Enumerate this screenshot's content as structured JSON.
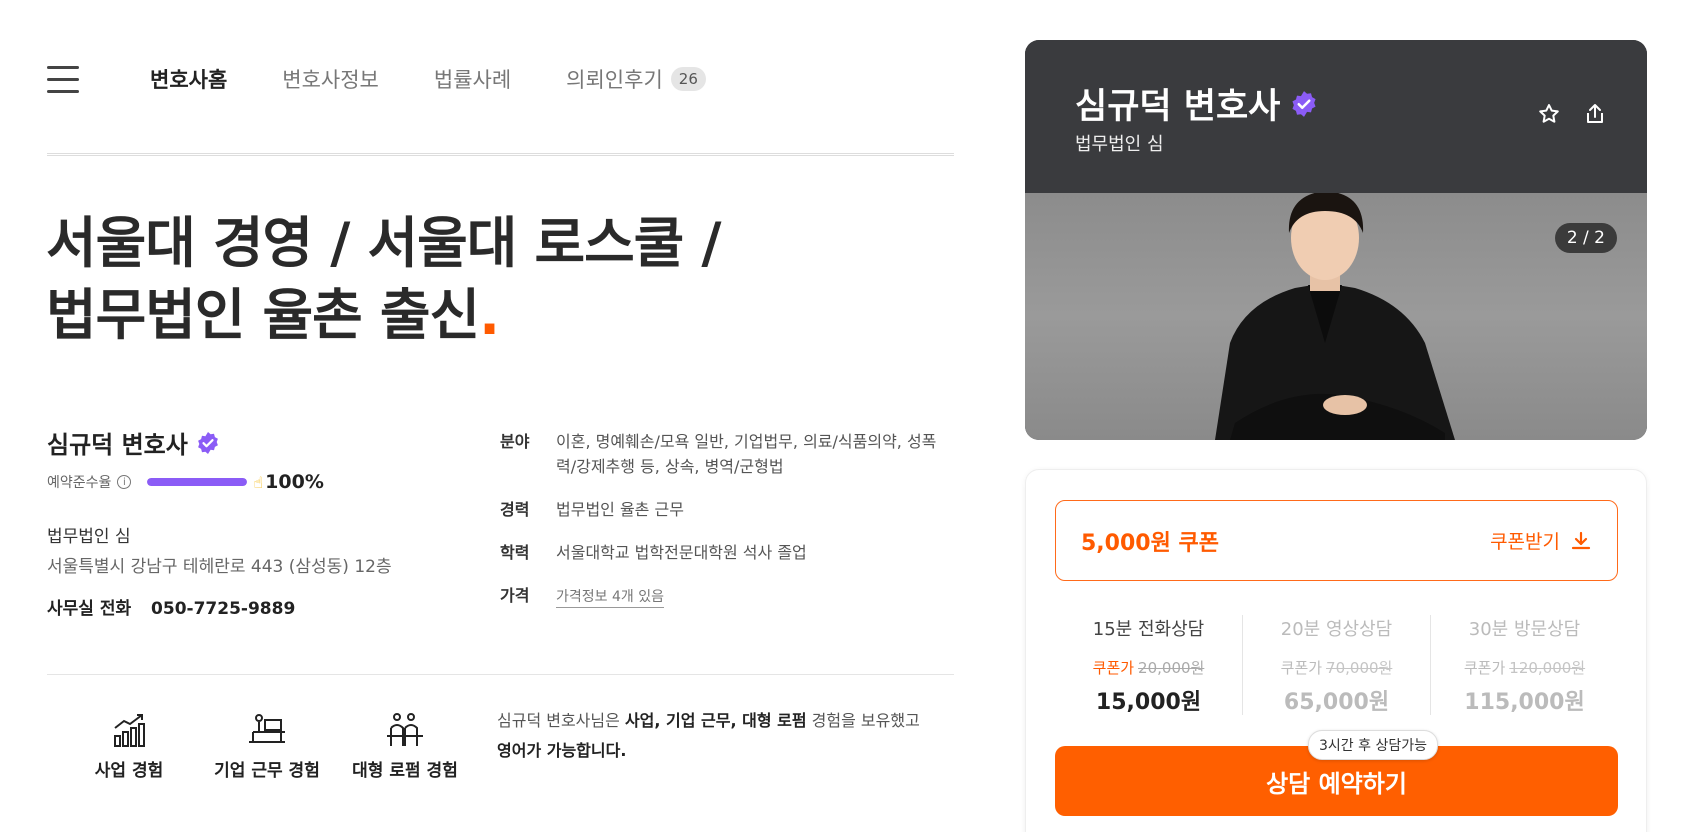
{
  "nav": {
    "tabs": [
      {
        "label": "변호사홈"
      },
      {
        "label": "변호사정보"
      },
      {
        "label": "법률사례"
      },
      {
        "label": "의뢰인후기",
        "count": "26"
      }
    ]
  },
  "headline": {
    "line1": "서울대 경영 / 서울대 로스쿨 /",
    "line2": "법무법인 율촌 출신",
    "dot": "."
  },
  "lawyer": {
    "name": "심규덕 변호사",
    "rate_label": "예약준수율",
    "rate_value": "100%",
    "rate_fraction": 1.0,
    "firm": "법무법인 심",
    "address": "서울특별시 강남구 테헤란로 443 (삼성동) 12층",
    "phone_label": "사무실 전화",
    "phone": "050-7725-9889"
  },
  "details": [
    {
      "label": "분야",
      "value": "이혼, 명예훼손/모욕 일반, 기업법무, 의료/식품의약, 성폭력/강제추행 등, 상속, 병역/군형법"
    },
    {
      "label": "경력",
      "value": "법무법인 율촌 근무"
    },
    {
      "label": "학력",
      "value": "서울대학교 법학전문대학원 석사 졸업"
    },
    {
      "label": "가격",
      "value": "가격정보 4개 있음"
    }
  ],
  "experiences": [
    {
      "label": "사업 경험",
      "icon": "chart-growth-icon"
    },
    {
      "label": "기업 근무 경험",
      "icon": "office-desk-icon"
    },
    {
      "label": "대형 로펌 경험",
      "icon": "team-icon"
    }
  ],
  "experience_desc": {
    "p1": "심규덕 변호사님은 ",
    "b1": "사업, 기업 근무, 대형 로펌",
    "p2": " 경험을 보유했고",
    "b2": "영어가 가능합니다."
  },
  "card": {
    "name": "심규덕 변호사",
    "firm": "법무법인 심",
    "pager": "2 / 2"
  },
  "booking": {
    "coupon_title": "5,000원 쿠폰",
    "coupon_button": "쿠폰받기",
    "options": [
      {
        "name": "15분 전화상담",
        "coupon_label": "쿠폰가",
        "original": "20,000원",
        "price": "15,000원"
      },
      {
        "name": "20분 영상상담",
        "coupon_label": "쿠폰가",
        "original": "70,000원",
        "price": "65,000원"
      },
      {
        "name": "30분 방문상담",
        "coupon_label": "쿠폰가",
        "original": "120,000원",
        "price": "115,000원"
      }
    ],
    "tip": "3시간 후 상담가능",
    "cta": "상담 예약하기"
  },
  "colors": {
    "accent": "#ff5f00",
    "verify": "#8b5cf6",
    "card_bg": "#3a3b3e"
  }
}
